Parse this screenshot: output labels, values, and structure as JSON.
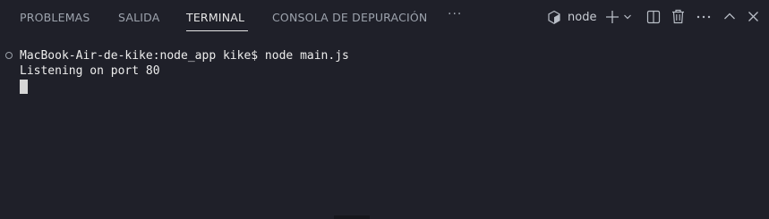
{
  "tabs": [
    {
      "label": "PROBLEMAS",
      "active": false
    },
    {
      "label": "SALIDA",
      "active": false
    },
    {
      "label": "TERMINAL",
      "active": true
    },
    {
      "label": "CONSOLA DE DEPURACIÓN",
      "active": false
    }
  ],
  "tabs_overflow": "···",
  "toolbar": {
    "shell_icon": "cube-icon",
    "shell_label": "node",
    "new_terminal_icon": "plus-icon",
    "launch_profile_icon": "chevron-down-icon",
    "split_icon": "split-editor-icon",
    "kill_icon": "trash-icon",
    "more_icon": "ellipsis-icon",
    "maximize_icon": "chevron-up-icon",
    "close_icon": "close-icon"
  },
  "terminal": {
    "lines": [
      "MacBook-Air-de-kike:node_app kike$ node main.js",
      "Listening on port 80"
    ]
  },
  "colors": {
    "background": "#1f2029",
    "active_tab": "#e6e6e6",
    "inactive_tab": "#9da3ad",
    "text": "#ededed"
  }
}
